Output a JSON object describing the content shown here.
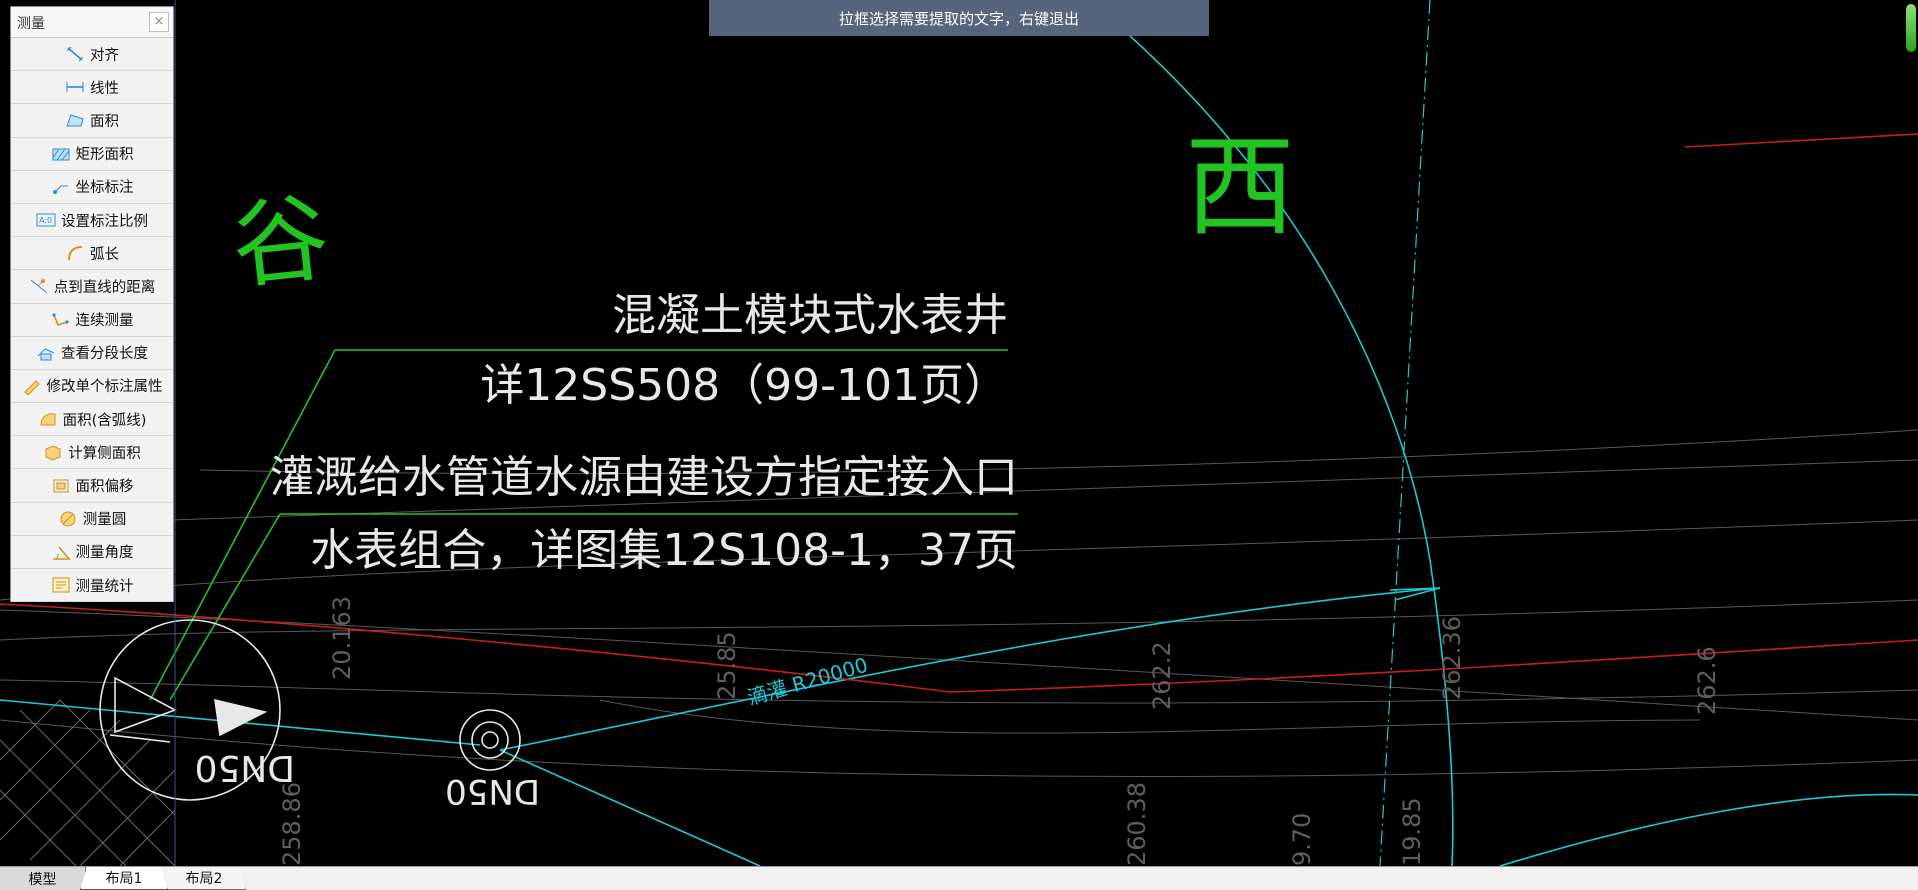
{
  "panel": {
    "title": "测量",
    "close_label": "×",
    "items": [
      {
        "label": "对齐",
        "icon": "aligned-dimension-icon"
      },
      {
        "label": "线性",
        "icon": "linear-dimension-icon"
      },
      {
        "label": "面积",
        "icon": "area-icon"
      },
      {
        "label": "矩形面积",
        "icon": "rectangle-area-icon"
      },
      {
        "label": "坐标标注",
        "icon": "coordinate-annotation-icon"
      },
      {
        "label": "设置标注比例",
        "icon": "annotation-scale-icon"
      },
      {
        "label": "弧长",
        "icon": "arc-length-icon"
      },
      {
        "label": "点到直线的距离",
        "icon": "point-to-line-distance-icon"
      },
      {
        "label": "连续测量",
        "icon": "continuous-measure-icon"
      },
      {
        "label": "查看分段长度",
        "icon": "segment-length-icon"
      },
      {
        "label": "修改单个标注属性",
        "icon": "edit-annotation-icon"
      },
      {
        "label": "面积(含弧线)",
        "icon": "area-with-arc-icon"
      },
      {
        "label": "计算侧面积",
        "icon": "side-area-icon"
      },
      {
        "label": "面积偏移",
        "icon": "area-offset-icon"
      },
      {
        "label": "测量圆",
        "icon": "measure-circle-icon"
      },
      {
        "label": "测量角度",
        "icon": "measure-angle-icon"
      },
      {
        "label": "测量统计",
        "icon": "measure-statistics-icon"
      }
    ]
  },
  "hint": "拉框选择需要提取的文字，右键退出",
  "drawing": {
    "label_valley": "谷",
    "label_west": "西",
    "note_line1": "混凝土模块式水表井",
    "note_line2": "详12SS508（99-101页）",
    "note_line3": "灌溉给水管道水源由建设方指定接入口",
    "note_line4": "水表组合，详图集12S108-1，37页",
    "pipe_label": "滴灌 R20000",
    "dn_label_1": "DN50",
    "dn_label_2": "DN50",
    "elevations": [
      "20.163",
      "25.85",
      "262.2",
      "262.36",
      "262.6",
      "260.38",
      "258.86",
      "9.70",
      "19.85"
    ]
  },
  "tabs": {
    "model": "模型",
    "layout1": "布局1",
    "layout2": "布局2"
  },
  "colors": {
    "background": "#000000",
    "green": "#22c422",
    "cyan": "#1ec8d6",
    "red": "#c81e1e",
    "white": "#e8e8e8",
    "hint_bg": "#56647d"
  }
}
